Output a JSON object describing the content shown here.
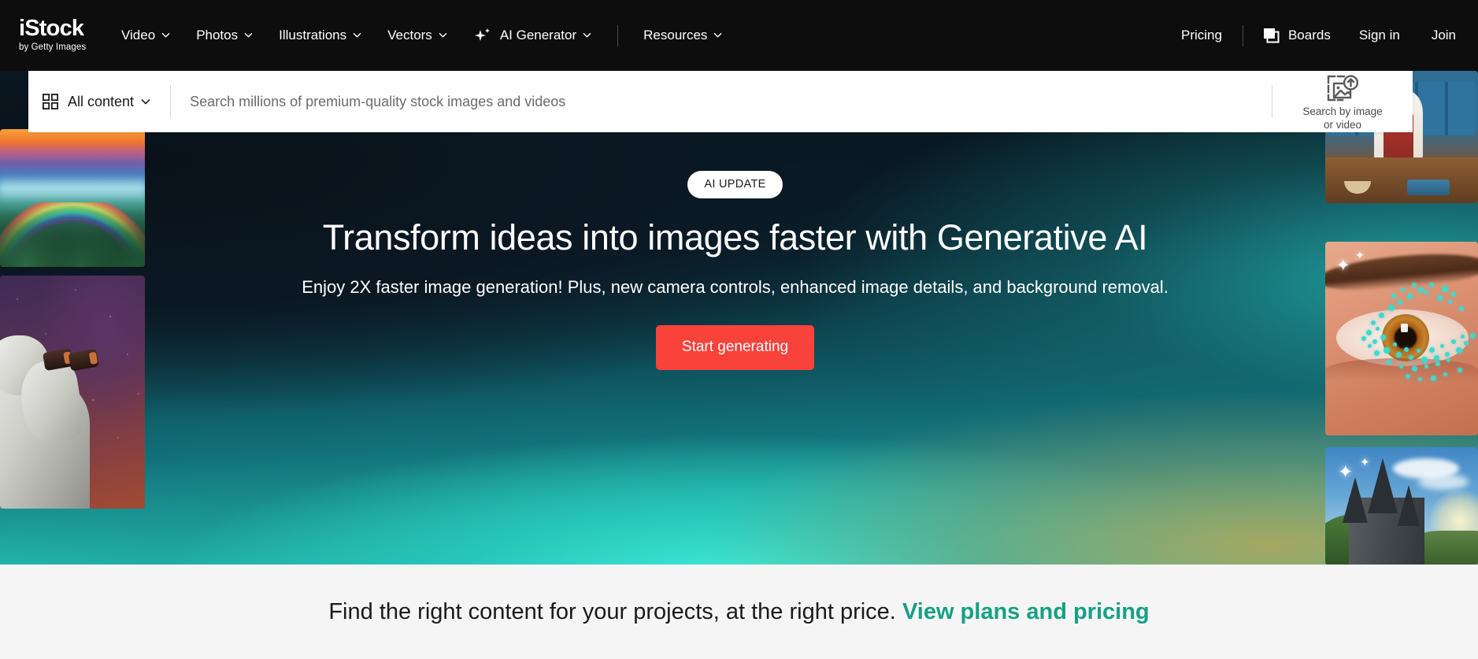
{
  "brand": {
    "logo_main": "iStock",
    "logo_sub": "by Getty Images"
  },
  "nav": {
    "main_items": [
      {
        "label": "Video",
        "has_chevron": true,
        "icon": null
      },
      {
        "label": "Photos",
        "has_chevron": true,
        "icon": null
      },
      {
        "label": "Illustrations",
        "has_chevron": true,
        "icon": null
      },
      {
        "label": "Vectors",
        "has_chevron": true,
        "icon": null
      },
      {
        "label": "AI Generator",
        "has_chevron": true,
        "icon": "sparkle-icon"
      },
      {
        "label": "Resources",
        "has_chevron": true,
        "icon": null
      }
    ],
    "right_items": [
      {
        "label": "Pricing",
        "icon": null
      },
      {
        "label": "Boards",
        "icon": "boards-stack-icon"
      },
      {
        "label": "Sign in",
        "icon": null
      },
      {
        "label": "Join",
        "icon": null
      }
    ]
  },
  "search": {
    "content_type_label": "All content",
    "content_type_icon": "grid-icon",
    "placeholder": "Search millions of premium-quality stock images and videos",
    "value": "",
    "search_by_image_label": "Search by image\nor video",
    "search_by_image_icon": "image-upload-icon"
  },
  "hero": {
    "badge": "AI UPDATE",
    "title": "Transform ideas into images faster with Generative AI",
    "subtitle": "Enjoy 2X faster image generation! Plus, new camera controls, enhanced image details, and background removal.",
    "cta_label": "Start generating",
    "cta_color": "#F9423A",
    "gradient_top": "#060D14",
    "gradient_bottom": "#2AD9C6",
    "gradient_accent": "#B2A85C"
  },
  "thumbnails": {
    "left": [
      {
        "name": "rainbow-mountain-landscape",
        "alt": "Rainbow over misty mountain ranges at sunset"
      },
      {
        "name": "statue-with-binoculars",
        "alt": "Classical marble statue looking through binoculars on a purple starry background"
      }
    ],
    "right": [
      {
        "name": "chef-in-kitchen",
        "alt": "Chef cooking in a blue kitchen"
      },
      {
        "name": "eye-with-teal-dots",
        "alt": "Close-up of a human eye with turquoise glitter dots"
      },
      {
        "name": "gothic-castle",
        "alt": "Gothic castle spires against a blue sky"
      }
    ]
  },
  "bottom_band": {
    "text": "Find the right content for your projects, at the right price. ",
    "link_label": "View plans and pricing",
    "link_color": "#16A085"
  }
}
